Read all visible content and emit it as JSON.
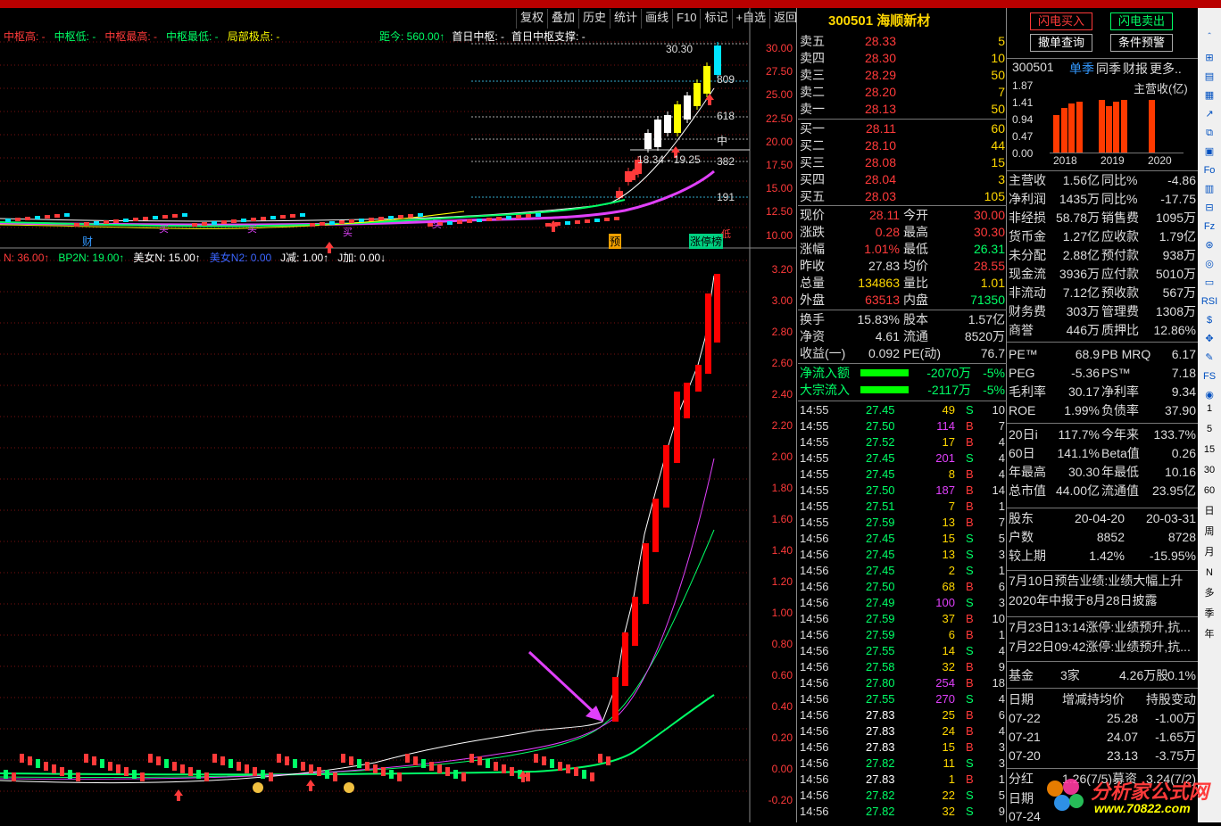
{
  "toolbar": {
    "items": [
      "复权",
      "叠加",
      "历史",
      "统计",
      "画线",
      "F10",
      "标记",
      "+自选",
      "返回"
    ]
  },
  "price_legend": [
    {
      "text": "中枢高: -",
      "color": "#ff3a3a"
    },
    {
      "text": "中枢低: -",
      "color": "#00ff66"
    },
    {
      "text": "中枢最高: -",
      "color": "#ff3a3a"
    },
    {
      "text": "中枢最低: -",
      "color": "#00ff66"
    },
    {
      "text": "局部极点: -",
      "color": "#ffff00"
    }
  ],
  "right_legend": [
    {
      "text": "距今: 560.00↑",
      "color": "#00ff66"
    },
    {
      "text": "首日中枢: -",
      "color": "#ffffff"
    },
    {
      "text": "首日中枢支撑: -",
      "color": "#ffffff"
    }
  ],
  "indicator_legend": [
    {
      "text": "N: 36.00↑",
      "color": "#ff3a3a"
    },
    {
      "text": "BP2N: 19.00↑",
      "color": "#00ff66"
    },
    {
      "text": "美女N: 15.00↑",
      "color": "#ffffff"
    },
    {
      "text": "美女N2: 0.00",
      "color": "#3a66ff"
    },
    {
      "text": "J减: 1.00↑",
      "color": "#ffffff"
    },
    {
      "text": "J加: 0.00↓",
      "color": "#ffffff"
    }
  ],
  "price_axis": [
    "30.00",
    "27.50",
    "25.00",
    "22.50",
    "20.00",
    "17.50",
    "15.00",
    "12.50",
    "10.00"
  ],
  "ind_axis": [
    "3.20",
    "3.00",
    "2.80",
    "2.60",
    "2.40",
    "2.20",
    "2.00",
    "1.80",
    "1.60",
    "1.40",
    "1.20",
    "1.00",
    "0.80",
    "0.60",
    "0.40",
    "0.20",
    "0.00",
    "-0.20"
  ],
  "chart_labels": {
    "high": "30.30",
    "r809": "809",
    "r618": "618",
    "mid": "中",
    "r382": "382",
    "r191": "191",
    "low_range": "18.34 - 19.25",
    "cai": "财",
    "mai1": "买",
    "mai2": "买",
    "mai3": "买",
    "mai4": "买",
    "yu": "预",
    "zhangting": "涨停榜",
    "di": "低"
  },
  "stock": {
    "code": "300501",
    "name": "海顺新材"
  },
  "asks": [
    {
      "label": "卖五",
      "price": "28.33",
      "vol": "5"
    },
    {
      "label": "卖四",
      "price": "28.30",
      "vol": "10"
    },
    {
      "label": "卖三",
      "price": "28.29",
      "vol": "50"
    },
    {
      "label": "卖二",
      "price": "28.20",
      "vol": "7"
    },
    {
      "label": "卖一",
      "price": "28.13",
      "vol": "50"
    }
  ],
  "bids": [
    {
      "label": "买一",
      "price": "28.11",
      "vol": "60"
    },
    {
      "label": "买二",
      "price": "28.10",
      "vol": "44"
    },
    {
      "label": "买三",
      "price": "28.08",
      "vol": "15"
    },
    {
      "label": "买四",
      "price": "28.04",
      "vol": "3"
    },
    {
      "label": "买五",
      "price": "28.03",
      "vol": "105"
    }
  ],
  "stats": [
    {
      "l1": "现价",
      "v1": "28.11",
      "c1": "#ff3a3a",
      "l2": "今开",
      "v2": "30.00",
      "c2": "#ff3a3a"
    },
    {
      "l1": "涨跌",
      "v1": "0.28",
      "c1": "#ff3a3a",
      "l2": "最高",
      "v2": "30.30",
      "c2": "#ff3a3a"
    },
    {
      "l1": "涨幅",
      "v1": "1.01%",
      "c1": "#ff3a3a",
      "l2": "最低",
      "v2": "26.31",
      "c2": "#00ff66"
    },
    {
      "l1": "昨收",
      "v1": "27.83",
      "c1": "#ddd",
      "l2": "均价",
      "v2": "28.55",
      "c2": "#ff3a3a"
    },
    {
      "l1": "总量",
      "v1": "134863",
      "c1": "#ffd700",
      "l2": "量比",
      "v2": "1.01",
      "c2": "#ffd700"
    },
    {
      "l1": "外盘",
      "v1": "63513",
      "c1": "#ff3a3a",
      "l2": "内盘",
      "v2": "71350",
      "c2": "#00ff66"
    }
  ],
  "stats2": [
    {
      "l1": "换手",
      "v1": "15.83%",
      "l2": "股本",
      "v2": "1.57亿"
    },
    {
      "l1": "净资",
      "v1": "4.61",
      "l2": "流通",
      "v2": "8520万"
    },
    {
      "l1": "收益(一)",
      "v1": "0.092",
      "l2": "PE(动)",
      "v2": "76.7"
    }
  ],
  "flows": [
    {
      "label": "净流入额",
      "value": "-2070万",
      "pct": "-5%"
    },
    {
      "label": "大宗流入",
      "value": "-2117万",
      "pct": "-5%"
    }
  ],
  "ticks": [
    {
      "t": "14:55",
      "p": "27.45",
      "v": "49",
      "s": "S",
      "n": "10",
      "pc": "#00ff66",
      "vc": "#ffd700"
    },
    {
      "t": "14:55",
      "p": "27.50",
      "v": "114",
      "s": "B",
      "n": "7",
      "pc": "#00ff66",
      "vc": "#e040fb"
    },
    {
      "t": "14:55",
      "p": "27.52",
      "v": "17",
      "s": "B",
      "n": "4",
      "pc": "#00ff66",
      "vc": "#ffd700"
    },
    {
      "t": "14:55",
      "p": "27.45",
      "v": "201",
      "s": "S",
      "n": "4",
      "pc": "#00ff66",
      "vc": "#e040fb"
    },
    {
      "t": "14:55",
      "p": "27.45",
      "v": "8",
      "s": "B",
      "n": "4",
      "pc": "#00ff66",
      "vc": "#ffd700"
    },
    {
      "t": "14:55",
      "p": "27.50",
      "v": "187",
      "s": "B",
      "n": "14",
      "pc": "#00ff66",
      "vc": "#e040fb"
    },
    {
      "t": "14:55",
      "p": "27.51",
      "v": "7",
      "s": "B",
      "n": "1",
      "pc": "#00ff66",
      "vc": "#ffd700"
    },
    {
      "t": "14:55",
      "p": "27.59",
      "v": "13",
      "s": "B",
      "n": "7",
      "pc": "#00ff66",
      "vc": "#ffd700"
    },
    {
      "t": "14:56",
      "p": "27.45",
      "v": "15",
      "s": "S",
      "n": "5",
      "pc": "#00ff66",
      "vc": "#ffd700"
    },
    {
      "t": "14:56",
      "p": "27.45",
      "v": "13",
      "s": "S",
      "n": "3",
      "pc": "#00ff66",
      "vc": "#ffd700"
    },
    {
      "t": "14:56",
      "p": "27.45",
      "v": "2",
      "s": "S",
      "n": "1",
      "pc": "#00ff66",
      "vc": "#ffd700"
    },
    {
      "t": "14:56",
      "p": "27.50",
      "v": "68",
      "s": "B",
      "n": "6",
      "pc": "#00ff66",
      "vc": "#ffd700"
    },
    {
      "t": "14:56",
      "p": "27.49",
      "v": "100",
      "s": "S",
      "n": "3",
      "pc": "#00ff66",
      "vc": "#e040fb"
    },
    {
      "t": "14:56",
      "p": "27.59",
      "v": "37",
      "s": "B",
      "n": "10",
      "pc": "#00ff66",
      "vc": "#ffd700"
    },
    {
      "t": "14:56",
      "p": "27.59",
      "v": "6",
      "s": "B",
      "n": "1",
      "pc": "#00ff66",
      "vc": "#ffd700"
    },
    {
      "t": "14:56",
      "p": "27.55",
      "v": "14",
      "s": "S",
      "n": "4",
      "pc": "#00ff66",
      "vc": "#ffd700"
    },
    {
      "t": "14:56",
      "p": "27.58",
      "v": "32",
      "s": "B",
      "n": "9",
      "pc": "#00ff66",
      "vc": "#ffd700"
    },
    {
      "t": "14:56",
      "p": "27.80",
      "v": "254",
      "s": "B",
      "n": "18",
      "pc": "#00ff66",
      "vc": "#e040fb"
    },
    {
      "t": "14:56",
      "p": "27.55",
      "v": "270",
      "s": "S",
      "n": "4",
      "pc": "#00ff66",
      "vc": "#e040fb"
    },
    {
      "t": "14:56",
      "p": "27.83",
      "v": "25",
      "s": "B",
      "n": "6",
      "pc": "#ffffff",
      "vc": "#ffd700"
    },
    {
      "t": "14:56",
      "p": "27.83",
      "v": "24",
      "s": "B",
      "n": "4",
      "pc": "#ffffff",
      "vc": "#ffd700"
    },
    {
      "t": "14:56",
      "p": "27.83",
      "v": "15",
      "s": "B",
      "n": "3",
      "pc": "#ffffff",
      "vc": "#ffd700"
    },
    {
      "t": "14:56",
      "p": "27.82",
      "v": "11",
      "s": "S",
      "n": "3",
      "pc": "#00ff66",
      "vc": "#ffd700"
    },
    {
      "t": "14:56",
      "p": "27.83",
      "v": "1",
      "s": "B",
      "n": "1",
      "pc": "#ffffff",
      "vc": "#ffd700"
    },
    {
      "t": "14:56",
      "p": "27.82",
      "v": "22",
      "s": "S",
      "n": "5",
      "pc": "#00ff66",
      "vc": "#ffd700"
    },
    {
      "t": "14:56",
      "p": "27.82",
      "v": "32",
      "s": "S",
      "n": "9",
      "pc": "#00ff66",
      "vc": "#ffd700"
    }
  ],
  "fin": {
    "buy_btn": "闪电买入",
    "sell_btn": "闪电卖出",
    "cancel_btn": "撤单查询",
    "cond_btn": "条件预警",
    "code": "300501",
    "tabs": [
      "单季",
      "同季",
      "财报",
      "更多.."
    ],
    "rev_axis": [
      "1.87",
      "1.41",
      "0.94",
      "0.47",
      "0.00"
    ],
    "rev_label": "主营收(亿)",
    "years": [
      "2018",
      "2019",
      "2020"
    ],
    "rows": [
      {
        "l1": "主营收",
        "v1": "1.56亿",
        "l2": "同比%",
        "v2": "-4.86"
      },
      {
        "l1": "净利润",
        "v1": "1435万",
        "l2": "同比%",
        "v2": "-17.75"
      },
      {
        "l1": "非经损",
        "v1": "58.78万",
        "l2": "销售费",
        "v2": "1095万"
      },
      {
        "l1": "货币金",
        "v1": "1.27亿",
        "l2": "应收款",
        "v2": "1.79亿"
      },
      {
        "l1": "未分配",
        "v1": "2.88亿",
        "l2": "预付款",
        "v2": "938万"
      },
      {
        "l1": "现金流",
        "v1": "3936万",
        "l2": "应付款",
        "v2": "5010万"
      },
      {
        "l1": "非流动",
        "v1": "7.12亿",
        "l2": "预收款",
        "v2": "567万"
      },
      {
        "l1": "财务费",
        "v1": "303万",
        "l2": "管理费",
        "v2": "1308万"
      },
      {
        "l1": "商誉",
        "v1": "446万",
        "l2": "质押比",
        "v2": "12.86%"
      }
    ],
    "ratios": [
      {
        "l1": "PE™",
        "v1": "68.9",
        "l2": "PB MRQ",
        "v2": "6.17"
      },
      {
        "l1": "PEG",
        "v1": "-5.36",
        "l2": "PS™",
        "v2": "7.18"
      },
      {
        "l1": "毛利率",
        "v1": "30.17",
        "l2": "净利率",
        "v2": "9.34"
      },
      {
        "l1": "ROE",
        "v1": "1.99%",
        "l2": "负债率",
        "v2": "37.90"
      }
    ],
    "perf": [
      {
        "l1": "20日i",
        "v1": "117.7%",
        "l2": "今年来",
        "v2": "133.7%"
      },
      {
        "l1": "60日",
        "v1": "141.1%",
        "l2": "Beta值",
        "v2": "0.26"
      },
      {
        "l1": "年最高",
        "v1": "30.30",
        "l2": "年最低",
        "v2": "10.16"
      },
      {
        "l1": "总市值",
        "v1": "44.00亿",
        "l2": "流通值",
        "v2": "23.95亿"
      }
    ],
    "holders": [
      {
        "l": "股东",
        "a": "20-04-20",
        "b": "20-03-31"
      },
      {
        "l": "户数",
        "a": "8852",
        "b": "8728"
      },
      {
        "l": "较上期",
        "a": "1.42%",
        "b": "-15.95%"
      }
    ],
    "news": [
      "7月10日预告业绩:业绩大幅上升",
      "2020年中报于8月28日披露",
      "7月23日13:14涨停:业绩预升,抗...",
      "7月22日09:42涨停:业绩预升,抗..."
    ],
    "fund": {
      "l": "基金",
      "a": "3家",
      "b": "4.26万股",
      "c": "0.1%"
    },
    "trades_header": {
      "a": "日期",
      "b": "增减持均价",
      "c": "持股变动"
    },
    "trades": [
      {
        "d": "07-22",
        "p": "25.28",
        "c": "-1.00万"
      },
      {
        "d": "07-21",
        "p": "24.07",
        "c": "-1.65万"
      },
      {
        "d": "07-20",
        "p": "23.13",
        "c": "-3.75万"
      }
    ],
    "dividend": {
      "l": "分红",
      "v": "1.26(7/5)募资",
      "w": "3.24(7/2)"
    },
    "last_date": {
      "l": "日期",
      "d": "07-24"
    }
  },
  "sidebar": [
    "＾",
    "⊞",
    "▤",
    "▦",
    "↗",
    "⧉",
    "▣",
    "Fo",
    "▥",
    "⊟",
    "Fz",
    "⊛",
    "◎",
    "▭",
    "RSI",
    "$",
    "✥",
    "✎",
    "FS",
    "◉",
    "1",
    "5",
    "15",
    "30",
    "60",
    "日",
    "周",
    "月",
    "N",
    "多",
    "季",
    "年"
  ],
  "watermark": {
    "text": "分析家公式网",
    "url": "www.70822.com"
  }
}
